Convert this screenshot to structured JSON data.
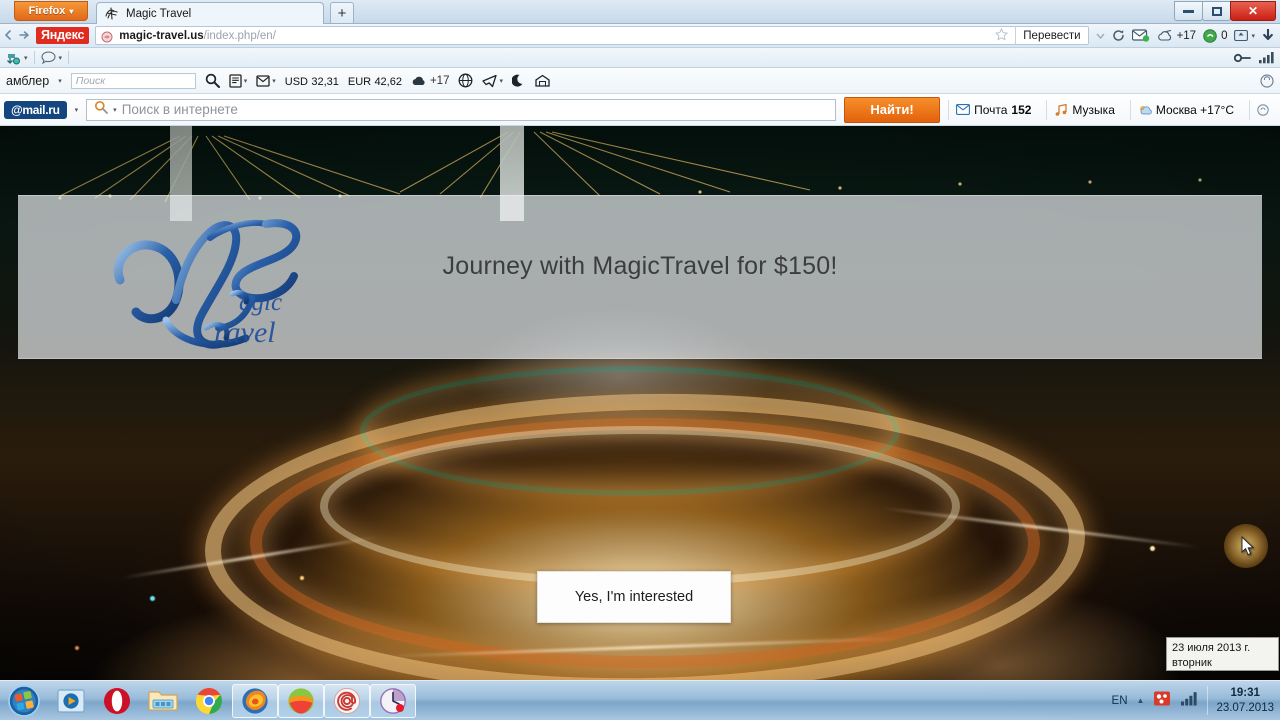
{
  "browser": {
    "app_button_label": "Firefox",
    "tab_title": "Magic Travel",
    "new_tab_label": "+",
    "back_label": "◄",
    "forward_label": "➔",
    "search_engine_label": "Яндекс",
    "url_domain": "magic-travel.us",
    "url_path": "/index.php/en/",
    "translate_label": "Перевести",
    "reload_label": "⟳",
    "dropdown_caret": "▾",
    "weather_value": "+17",
    "notifications_count": "0",
    "window_controls": {
      "minimize": "minimize-icon",
      "restore": "restore-icon",
      "close": "✕"
    }
  },
  "rambler_toolbar": {
    "brand_label": "амблер",
    "brand_caret": "▾",
    "search_placeholder": "Поиск",
    "usd_label": "USD",
    "usd_value": "32,31",
    "eur_label": "EUR",
    "eur_value": "42,62",
    "weather_value": "+17",
    "icons": [
      "search-icon",
      "news-icon",
      "mail-icon",
      "cloud-icon",
      "globe-icon",
      "telegram-icon",
      "moon-icon",
      "cinema-icon"
    ]
  },
  "mailru_toolbar": {
    "brand_label": "@mail.ru",
    "search_placeholder": "Поиск в интернете",
    "find_button_label": "Найти!",
    "mail_label": "Почта",
    "mail_count": "152",
    "music_label": "Музыка",
    "weather_label": "Москва +17°C"
  },
  "page": {
    "headline": "Journey with MagicTravel for $150!",
    "logo_name": "magic-travel-logo",
    "cta_label": "Yes, I'm interested"
  },
  "tooltip": {
    "date_line": "23 июля 2013 г.",
    "weekday_line": "вторник"
  },
  "taskbar": {
    "start_label": "start-orb",
    "items": [
      {
        "name": "media-player-icon",
        "title": "Windows Media Player"
      },
      {
        "name": "opera-icon",
        "title": "Opera"
      },
      {
        "name": "explorer-icon",
        "title": "Windows Explorer"
      },
      {
        "name": "chrome-icon",
        "title": "Google Chrome"
      },
      {
        "name": "firefox-icon",
        "title": "Mozilla Firefox"
      },
      {
        "name": "browser-icon",
        "title": "Browser"
      },
      {
        "name": "mailru-agent-icon",
        "title": "Mail.ru Agent"
      },
      {
        "name": "clock-app-icon",
        "title": "Clock"
      }
    ],
    "tray": {
      "language": "EN",
      "show_hidden_label": "▲",
      "time": "19:31",
      "date": "23.07.2013"
    }
  },
  "colors": {
    "firefox_orange": "#e2681a",
    "yandex_red": "#e02b20",
    "mailru_blue": "#14457e",
    "find_button_orange": "#e2620c",
    "close_red": "#cc1f15",
    "logo_blue": "#1f4f9c",
    "headline_gray": "#3d3d3d"
  }
}
